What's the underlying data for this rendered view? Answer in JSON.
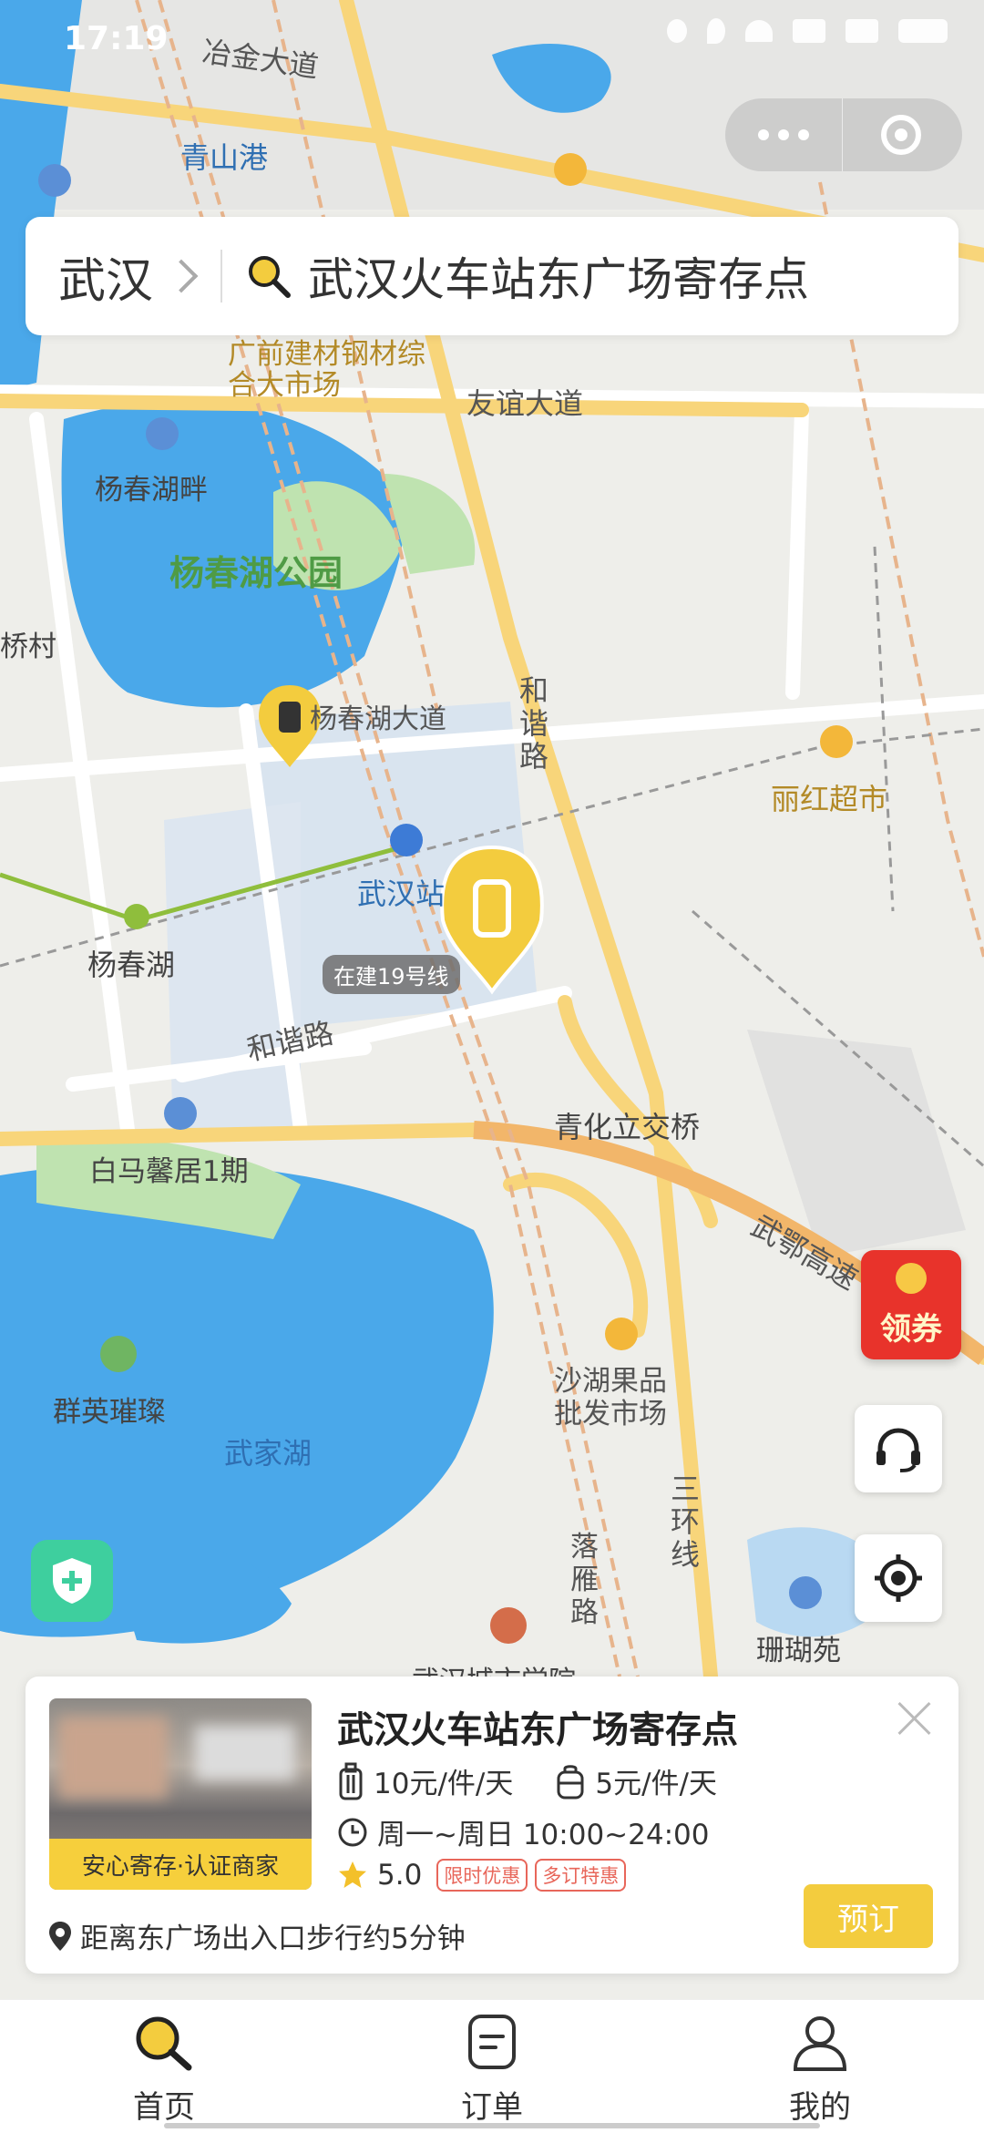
{
  "status": {
    "time": "17:19"
  },
  "search": {
    "city": "武汉",
    "query": "武汉火车站东广场寄存点"
  },
  "map": {
    "roads": [
      "冶金大道",
      "友谊大道",
      "和谐路",
      "三环线",
      "三环线",
      "武鄂高速",
      "落雁路",
      "杨春湖大道"
    ],
    "places": [
      "青山港",
      "广前建材钢材综合大市场",
      "杨春湖畔",
      "杨春湖公园",
      "杨春湖",
      "武汉站",
      "丽红超市",
      "青化立交桥",
      "白马馨居1期",
      "群英璀璨",
      "武家湖",
      "沙湖果品批发市场",
      "珊瑚苑",
      "武汉城市学院",
      "桥村",
      "在建19号线"
    ]
  },
  "coupon": {
    "label": "领券"
  },
  "card": {
    "title": "武汉火车站东广场寄存点",
    "badge": "安心寄存·认证商家",
    "price_large": "10元/件/天",
    "price_small": "5元/件/天",
    "hours": "周一~周日 10:00~24:00",
    "rating": "5.0",
    "tag1": "限时优惠",
    "tag2": "多订特惠",
    "distance": "距离东广场出入口步行约5分钟",
    "book_label": "预订"
  },
  "tabs": [
    {
      "label": "首页",
      "icon": "search-icon"
    },
    {
      "label": "订单",
      "icon": "order-icon"
    },
    {
      "label": "我的",
      "icon": "user-icon"
    }
  ],
  "colors": {
    "accent": "#f3cc3e",
    "water": "#4aa8ea",
    "park": "#bfe3b0",
    "road": "#f8d57a"
  }
}
